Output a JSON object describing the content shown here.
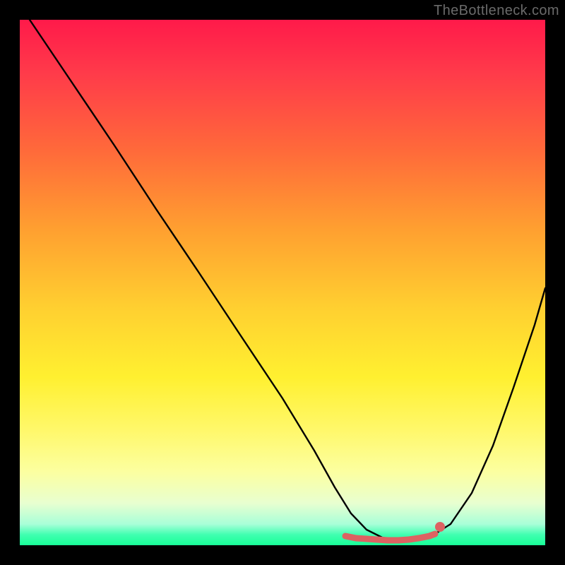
{
  "watermark": "TheBottleneck.com",
  "chart_data": {
    "type": "line",
    "title": "",
    "xlabel": "",
    "ylabel": "",
    "xlim": [
      0,
      100
    ],
    "ylim": [
      0,
      100
    ],
    "series": [
      {
        "name": "bottleneck-curve",
        "x": [
          2,
          10,
          18,
          26,
          34,
          42,
          50,
          56,
          60,
          63,
          66,
          69,
          72,
          74,
          76,
          78,
          82,
          86,
          90,
          94,
          98,
          100
        ],
        "y": [
          100,
          88,
          76,
          64,
          52,
          40,
          28,
          18,
          11,
          6,
          3,
          1.5,
          1,
          1,
          1,
          1.5,
          4,
          10,
          19,
          30,
          42,
          49
        ]
      },
      {
        "name": "valley-marker",
        "x": [
          62,
          64,
          66,
          68,
          70,
          72,
          74,
          76,
          78,
          79
        ],
        "y": [
          1.8,
          1.4,
          1.2,
          1.1,
          1.0,
          1.0,
          1.1,
          1.3,
          1.7,
          2.2
        ]
      }
    ],
    "marker_point": {
      "x": 80,
      "y": 3.5
    },
    "colors": {
      "curve": "#000000",
      "marker": "#dd6262"
    }
  }
}
